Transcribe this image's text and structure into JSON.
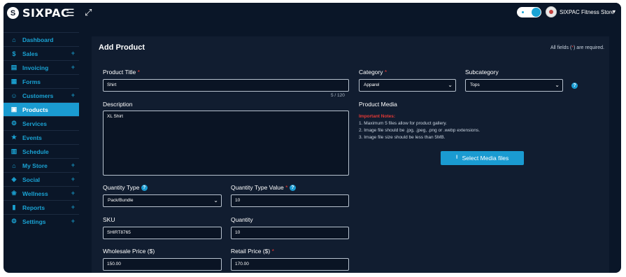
{
  "brand": {
    "logo_mark": "S",
    "name": "SIXPAC"
  },
  "topbar": {
    "menu_icon": "hamburger-icon",
    "expand_icon": "expand-icon",
    "store_name": "SIXPAC Fitness Store"
  },
  "sidebar": {
    "items": [
      {
        "label": "Dashboard",
        "icon": "home-icon",
        "glyph": "⌂",
        "expandable": false,
        "active": false
      },
      {
        "label": "Sales",
        "icon": "dollar-icon",
        "glyph": "$",
        "expandable": true,
        "active": false
      },
      {
        "label": "Invoicing",
        "icon": "invoice-icon",
        "glyph": "▤",
        "expandable": true,
        "active": false
      },
      {
        "label": "Forms",
        "icon": "forms-icon",
        "glyph": "▦",
        "expandable": false,
        "active": false
      },
      {
        "label": "Customers",
        "icon": "customers-icon",
        "glyph": "☺",
        "expandable": true,
        "active": false
      },
      {
        "label": "Products",
        "icon": "box-icon",
        "glyph": "▣",
        "expandable": false,
        "active": true
      },
      {
        "label": "Services",
        "icon": "services-icon",
        "glyph": "⚙",
        "expandable": false,
        "active": false
      },
      {
        "label": "Events",
        "icon": "events-icon",
        "glyph": "★",
        "expandable": false,
        "active": false
      },
      {
        "label": "Schedule",
        "icon": "calendar-icon",
        "glyph": "▥",
        "expandable": false,
        "active": false
      },
      {
        "label": "My Store",
        "icon": "store-icon",
        "glyph": "⌂",
        "expandable": true,
        "active": false
      },
      {
        "label": "Social",
        "icon": "social-icon",
        "glyph": "◈",
        "expandable": true,
        "active": false
      },
      {
        "label": "Wellness",
        "icon": "wellness-icon",
        "glyph": "❀",
        "expandable": true,
        "active": false
      },
      {
        "label": "Reports",
        "icon": "reports-icon",
        "glyph": "▮",
        "expandable": true,
        "active": false
      },
      {
        "label": "Settings",
        "icon": "settings-icon",
        "glyph": "⚙",
        "expandable": true,
        "active": false
      }
    ]
  },
  "form": {
    "title": "Add Product",
    "required_note_prefix": "All fields (",
    "required_note_star": "*",
    "required_note_suffix": ") are required.",
    "product_title": {
      "label": "Product Title",
      "value": "Shirt",
      "counter": "5 / 120"
    },
    "category": {
      "label": "Category",
      "value": "Apparel"
    },
    "subcategory": {
      "label": "Subcategory",
      "value": "Tops"
    },
    "description": {
      "label": "Description",
      "value": "XL Shirt"
    },
    "product_media": {
      "label": "Product Media",
      "notes_title": "Important Notes:",
      "notes": [
        "1. Maximum 5 files allow for product gallery.",
        "2. Image file should be .jpg, .jpeg, .png or .webp extensions.",
        "3. Image file size should be less than 5MB."
      ],
      "button_label": "Select Media files"
    },
    "quantity_type": {
      "label": "Quantity Type",
      "value": "Pack/Bundle"
    },
    "quantity_type_value": {
      "label": "Quantity Type Value",
      "value": "10"
    },
    "sku": {
      "label": "SKU",
      "value": "SHIRT8765"
    },
    "quantity": {
      "label": "Quantity",
      "value": "10"
    },
    "wholesale_price": {
      "label": "Wholesale Price ($)",
      "value": "150.00"
    },
    "retail_price": {
      "label": "Retail Price ($)",
      "value": "170.00"
    },
    "required_star": "*",
    "help_glyph": "?"
  },
  "colors": {
    "background": "#0a1628",
    "card": "#111d30",
    "accent": "#1a9bd1",
    "required": "#e53935"
  }
}
